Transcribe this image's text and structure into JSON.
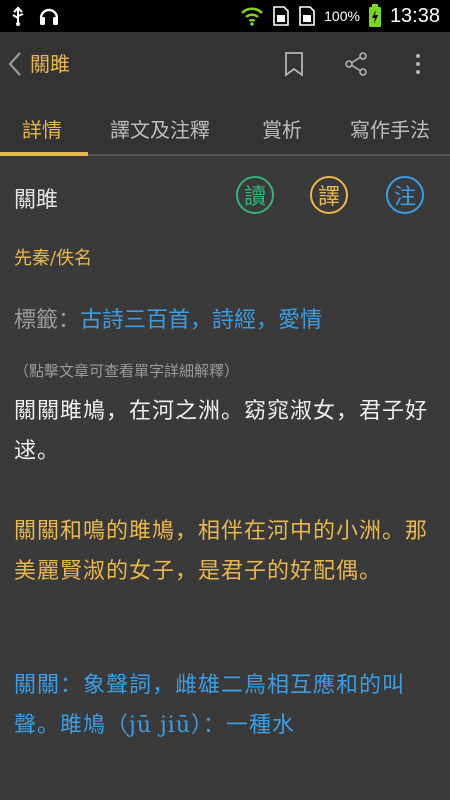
{
  "status_bar": {
    "battery_percent": "100%",
    "time": "13:38"
  },
  "app_bar": {
    "title": "關雎",
    "back_icon": "chevron-left-icon",
    "bookmark_icon": "bookmark-icon",
    "share_icon": "share-icon",
    "more_icon": "more-vert-icon"
  },
  "tabs": [
    {
      "label": "詳情",
      "active": true
    },
    {
      "label": "譯文及注釋",
      "active": false
    },
    {
      "label": "賞析",
      "active": false
    },
    {
      "label": "寫作手法",
      "active": false
    }
  ],
  "poem": {
    "title": "關雎",
    "buttons": {
      "read": "讀",
      "translate": "譯",
      "note": "注"
    },
    "author": "先秦/佚名",
    "tags_label": "標籤：",
    "tags": [
      "古詩三百首",
      "詩經",
      "愛情"
    ],
    "tag_separator": "，",
    "hint": "（點擊文章可查看單字詳細解釋）",
    "original": "關關雎鳩，在河之洲。窈窕淑女，君子好逑。",
    "translation": "關關和鳴的雎鳩，相伴在河中的小洲。那美麗賢淑的女子，是君子的好配偶。",
    "note": "關關：象聲詞，雌雄二鳥相互應和的叫聲。雎鳩（jū jiū）：一種水"
  },
  "colors": {
    "accent_gold": "#e8b84f",
    "accent_blue": "#3c9ee2",
    "accent_green": "#34b27a",
    "background": "#3a3a3a"
  }
}
